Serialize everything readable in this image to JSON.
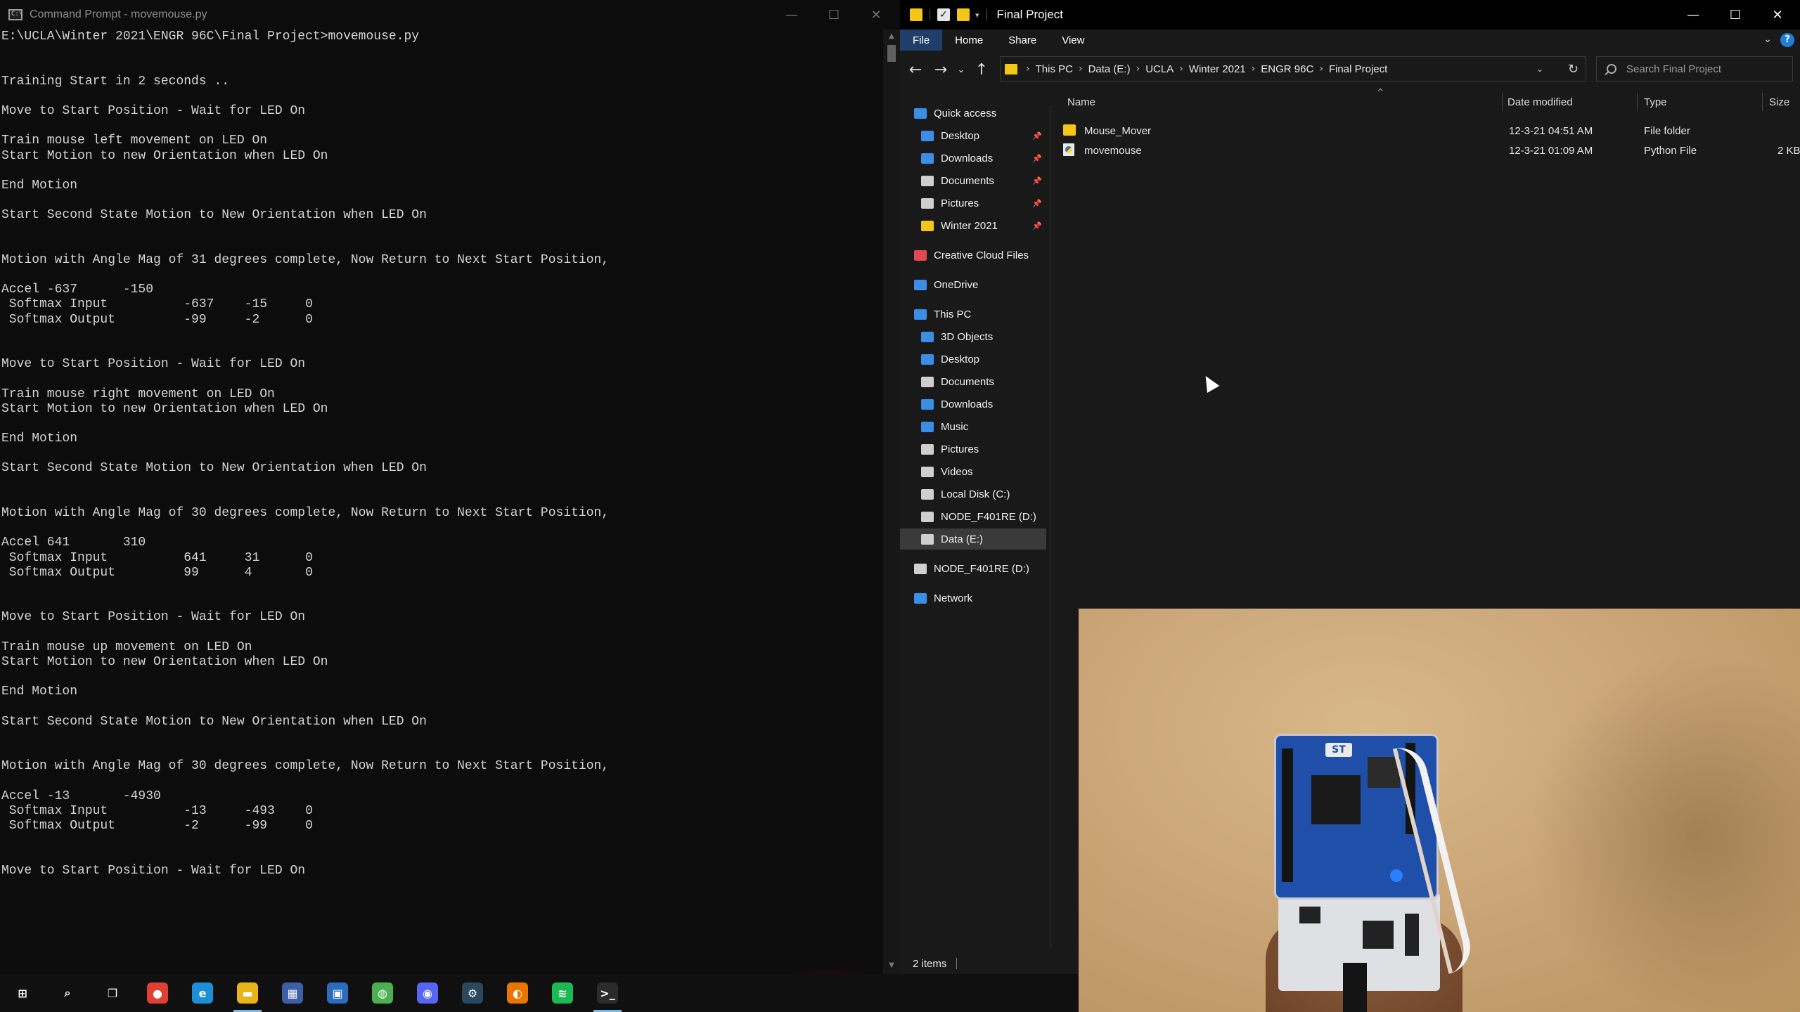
{
  "cmd": {
    "title": "Command Prompt - movemouse.py",
    "lines": [
      "E:\\UCLA\\Winter 2021\\ENGR 96C\\Final Project>movemouse.py",
      "",
      "",
      "Training Start in 2 seconds ..",
      "",
      "Move to Start Position - Wait for LED On",
      "",
      "Train mouse left movement on LED On",
      "Start Motion to new Orientation when LED On",
      "",
      "End Motion",
      "",
      "Start Second State Motion to New Orientation when LED On",
      "",
      "",
      "Motion with Angle Mag of 31 degrees complete, Now Return to Next Start Position,",
      "",
      "Accel -637      -150",
      " Softmax Input          -637    -15     0",
      " Softmax Output         -99     -2      0",
      "",
      "",
      "Move to Start Position - Wait for LED On",
      "",
      "Train mouse right movement on LED On",
      "Start Motion to new Orientation when LED On",
      "",
      "End Motion",
      "",
      "Start Second State Motion to New Orientation when LED On",
      "",
      "",
      "Motion with Angle Mag of 30 degrees complete, Now Return to Next Start Position,",
      "",
      "Accel 641       310",
      " Softmax Input          641     31      0",
      " Softmax Output         99      4       0",
      "",
      "",
      "Move to Start Position - Wait for LED On",
      "",
      "Train mouse up movement on LED On",
      "Start Motion to new Orientation when LED On",
      "",
      "End Motion",
      "",
      "Start Second State Motion to New Orientation when LED On",
      "",
      "",
      "Motion with Angle Mag of 30 degrees complete, Now Return to Next Start Position,",
      "",
      "Accel -13       -4930",
      " Softmax Input          -13     -493    0",
      " Softmax Output         -2      -99     0",
      "",
      "",
      "Move to Start Position - Wait for LED On"
    ]
  },
  "explorer": {
    "title": "Final Project",
    "tabs": [
      "File",
      "Home",
      "Share",
      "View"
    ],
    "breadcrumb": [
      "This PC",
      "Data (E:)",
      "UCLA",
      "Winter 2021",
      "ENGR 96C",
      "Final Project"
    ],
    "search_placeholder": "Search Final Project",
    "columns": [
      "Name",
      "Date modified",
      "Type",
      "Size"
    ],
    "files": [
      {
        "name": "Mouse_Mover",
        "date": "12-3-21 04:51 AM",
        "type": "File folder",
        "size": "",
        "icon": "folder-icon"
      },
      {
        "name": "movemouse",
        "date": "12-3-21 01:09 AM",
        "type": "Python File",
        "size": "2 KB",
        "icon": "python-file-icon"
      }
    ],
    "nav": [
      {
        "label": "Quick access",
        "icon": "star-icon",
        "color": "#3a8ee6"
      },
      {
        "label": "Desktop",
        "icon": "desktop-icon",
        "color": "#3a8ee6",
        "pinned": true
      },
      {
        "label": "Downloads",
        "icon": "download-icon",
        "color": "#3a8ee6",
        "pinned": true
      },
      {
        "label": "Documents",
        "icon": "documents-icon",
        "color": "#cfcfcf",
        "pinned": true
      },
      {
        "label": "Pictures",
        "icon": "pictures-icon",
        "color": "#cfcfcf",
        "pinned": true
      },
      {
        "label": "Winter 2021",
        "icon": "folder-icon",
        "color": "#f5c518",
        "pinned": true
      },
      {
        "label": "Creative Cloud Files",
        "icon": "creative-cloud-icon",
        "color": "#e34850"
      },
      {
        "label": "OneDrive",
        "icon": "cloud-icon",
        "color": "#3a8ee6"
      },
      {
        "label": "This PC",
        "icon": "computer-icon",
        "color": "#3a8ee6"
      },
      {
        "label": "3D Objects",
        "icon": "cube-icon",
        "color": "#3a8ee6"
      },
      {
        "label": "Desktop",
        "icon": "desktop-icon",
        "color": "#3a8ee6"
      },
      {
        "label": "Documents",
        "icon": "documents-icon",
        "color": "#cfcfcf"
      },
      {
        "label": "Downloads",
        "icon": "download-icon",
        "color": "#3a8ee6"
      },
      {
        "label": "Music",
        "icon": "music-icon",
        "color": "#3a8ee6"
      },
      {
        "label": "Pictures",
        "icon": "pictures-icon",
        "color": "#cfcfcf"
      },
      {
        "label": "Videos",
        "icon": "video-icon",
        "color": "#cfcfcf"
      },
      {
        "label": "Local Disk (C:)",
        "icon": "drive-icon",
        "color": "#cfcfcf"
      },
      {
        "label": "NODE_F401RE (D:)",
        "icon": "drive-icon",
        "color": "#cfcfcf"
      },
      {
        "label": "Data (E:)",
        "icon": "drive-icon",
        "color": "#cfcfcf",
        "selected": true
      },
      {
        "label": "NODE_F401RE (D:)",
        "icon": "drive-icon",
        "color": "#cfcfcf"
      },
      {
        "label": "Network",
        "icon": "network-icon",
        "color": "#3a8ee6"
      }
    ],
    "status": "2 items"
  },
  "taskbar": [
    {
      "name": "start-icon",
      "glyph": "⊞",
      "color": "#101010"
    },
    {
      "name": "search-icon",
      "glyph": "⌕",
      "color": "#101010"
    },
    {
      "name": "task-view-icon",
      "glyph": "❐",
      "color": "#101010"
    },
    {
      "name": "chrome-icon",
      "glyph": "●",
      "color": "#de4032"
    },
    {
      "name": "edge-icon",
      "glyph": "e",
      "color": "#1d8fd6"
    },
    {
      "name": "file-explorer-icon",
      "glyph": "▬",
      "color": "#e8b41a",
      "active": true
    },
    {
      "name": "app-icon",
      "glyph": "▦",
      "color": "#3d5fa8"
    },
    {
      "name": "notes-icon",
      "glyph": "▣",
      "color": "#2a6dbf"
    },
    {
      "name": "globe-icon",
      "glyph": "◍",
      "color": "#4caf50"
    },
    {
      "name": "discord-icon",
      "glyph": "◉",
      "color": "#5865f2"
    },
    {
      "name": "steam-icon",
      "glyph": "⚙",
      "color": "#2a475e"
    },
    {
      "name": "blender-icon",
      "glyph": "◐",
      "color": "#ea7600"
    },
    {
      "name": "spotify-icon",
      "glyph": "≋",
      "color": "#1db954"
    },
    {
      "name": "terminal-icon",
      "glyph": ">_",
      "color": "#2b2b2b",
      "active": true
    }
  ]
}
